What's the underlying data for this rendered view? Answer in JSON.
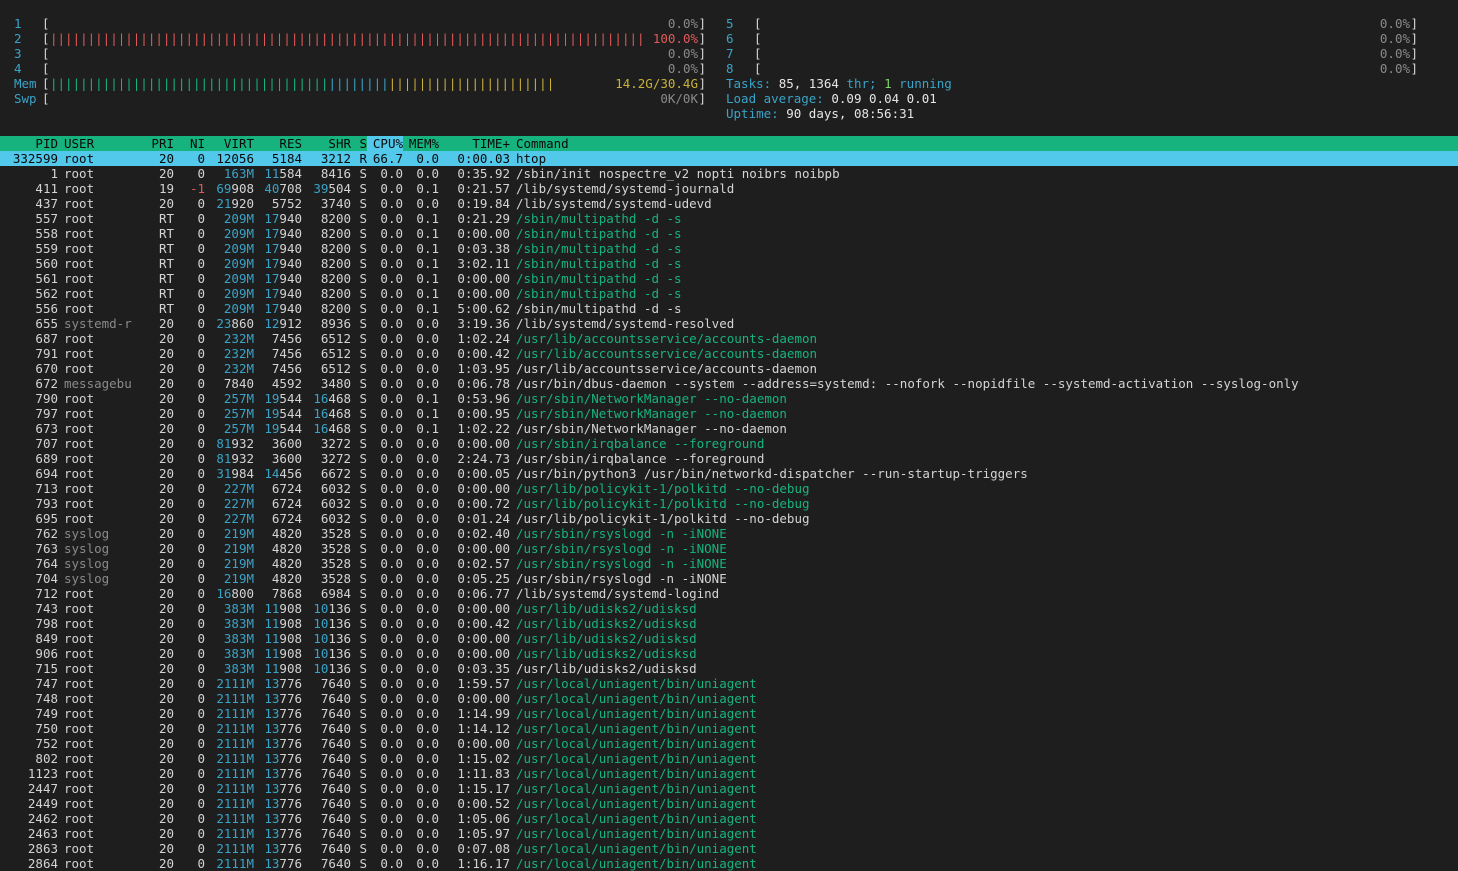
{
  "cpu_meters": {
    "left": [
      {
        "id": "1",
        "value": "0.0%",
        "fill": 0.0
      },
      {
        "id": "2",
        "value": "100.0%",
        "fill": 1.0
      },
      {
        "id": "3",
        "value": "0.0%",
        "fill": 0.0
      },
      {
        "id": "4",
        "value": "0.0%",
        "fill": 0.0
      }
    ],
    "right": [
      {
        "id": "5",
        "value": "0.0%",
        "fill": 0.0
      },
      {
        "id": "6",
        "value": "0.0%",
        "fill": 0.0
      },
      {
        "id": "7",
        "value": "0.0%",
        "fill": 0.0
      },
      {
        "id": "8",
        "value": "0.0%",
        "fill": 0.0
      }
    ]
  },
  "mem": {
    "label": "Mem",
    "value": "14.2G/30.4G",
    "used_fraction": 0.47
  },
  "swap": {
    "label": "Swp",
    "value": "0K/0K",
    "used_fraction": 0.0
  },
  "tasks": {
    "label": "Tasks:",
    "count": "85,",
    "threads": "1364",
    "thr_label": "thr;",
    "running": "1",
    "running_label": "running"
  },
  "load": {
    "label": "Load average:",
    "v1": "0.09",
    "v5": "0.04",
    "v15": "0.01"
  },
  "uptime": {
    "label": "Uptime:",
    "value": "90 days, 08:56:31"
  },
  "columns": {
    "pid": "PID",
    "user": "USER",
    "pri": "PRI",
    "ni": "NI",
    "virt": "VIRT",
    "res": "RES",
    "shr": "SHR",
    "s": "S",
    "cpu": "CPU%",
    "mem": "MEM%",
    "time": "TIME+",
    "command": "Command"
  },
  "colors": {
    "header_bg": "#17b37f",
    "selected_bg": "#52c8ea",
    "thread": "#17b37f",
    "label": "#3aa3c7",
    "cpu_bar": "#e05a5a",
    "mem_bar_used": "#17b37f",
    "mem_bar_buffer": "#3aa3c7",
    "mem_bar_cache": "#c8b23a"
  },
  "processes": [
    {
      "pid": "332599",
      "user": "root",
      "pri": "20",
      "ni": "0",
      "virt": "12056",
      "res": "5184",
      "shr": "3212",
      "s": "R",
      "cpu": "66.7",
      "mem": "0.0",
      "time": "0:00.03",
      "command": "htop",
      "selected": true
    },
    {
      "pid": "1",
      "user": "root",
      "pri": "20",
      "ni": "0",
      "virt": "163M",
      "res": "11584",
      "shr": "8416",
      "s": "S",
      "cpu": "0.0",
      "mem": "0.0",
      "time": "0:35.92",
      "command": "/sbin/init nospectre_v2 nopti noibrs noibpb"
    },
    {
      "pid": "411",
      "user": "root",
      "pri": "19",
      "ni": "-1",
      "virt": "69908",
      "res": "40708",
      "shr": "39504",
      "s": "S",
      "cpu": "0.0",
      "mem": "0.1",
      "time": "0:21.57",
      "command": "/lib/systemd/systemd-journald"
    },
    {
      "pid": "437",
      "user": "root",
      "pri": "20",
      "ni": "0",
      "virt": "21920",
      "res": "5752",
      "shr": "3740",
      "s": "S",
      "cpu": "0.0",
      "mem": "0.0",
      "time": "0:19.84",
      "command": "/lib/systemd/systemd-udevd"
    },
    {
      "pid": "557",
      "user": "root",
      "pri": "RT",
      "ni": "0",
      "virt": "209M",
      "res": "17940",
      "shr": "8200",
      "s": "S",
      "cpu": "0.0",
      "mem": "0.1",
      "time": "0:21.29",
      "command": "/sbin/multipathd -d -s",
      "thread": true
    },
    {
      "pid": "558",
      "user": "root",
      "pri": "RT",
      "ni": "0",
      "virt": "209M",
      "res": "17940",
      "shr": "8200",
      "s": "S",
      "cpu": "0.0",
      "mem": "0.1",
      "time": "0:00.00",
      "command": "/sbin/multipathd -d -s",
      "thread": true
    },
    {
      "pid": "559",
      "user": "root",
      "pri": "RT",
      "ni": "0",
      "virt": "209M",
      "res": "17940",
      "shr": "8200",
      "s": "S",
      "cpu": "0.0",
      "mem": "0.1",
      "time": "0:03.38",
      "command": "/sbin/multipathd -d -s",
      "thread": true
    },
    {
      "pid": "560",
      "user": "root",
      "pri": "RT",
      "ni": "0",
      "virt": "209M",
      "res": "17940",
      "shr": "8200",
      "s": "S",
      "cpu": "0.0",
      "mem": "0.1",
      "time": "3:02.11",
      "command": "/sbin/multipathd -d -s",
      "thread": true
    },
    {
      "pid": "561",
      "user": "root",
      "pri": "RT",
      "ni": "0",
      "virt": "209M",
      "res": "17940",
      "shr": "8200",
      "s": "S",
      "cpu": "0.0",
      "mem": "0.1",
      "time": "0:00.00",
      "command": "/sbin/multipathd -d -s",
      "thread": true
    },
    {
      "pid": "562",
      "user": "root",
      "pri": "RT",
      "ni": "0",
      "virt": "209M",
      "res": "17940",
      "shr": "8200",
      "s": "S",
      "cpu": "0.0",
      "mem": "0.1",
      "time": "0:00.00",
      "command": "/sbin/multipathd -d -s",
      "thread": true
    },
    {
      "pid": "556",
      "user": "root",
      "pri": "RT",
      "ni": "0",
      "virt": "209M",
      "res": "17940",
      "shr": "8200",
      "s": "S",
      "cpu": "0.0",
      "mem": "0.1",
      "time": "5:00.62",
      "command": "/sbin/multipathd -d -s"
    },
    {
      "pid": "655",
      "user": "systemd-r",
      "pri": "20",
      "ni": "0",
      "virt": "23860",
      "res": "12912",
      "shr": "8936",
      "s": "S",
      "cpu": "0.0",
      "mem": "0.0",
      "time": "3:19.36",
      "command": "/lib/systemd/systemd-resolved",
      "dim_user": true
    },
    {
      "pid": "687",
      "user": "root",
      "pri": "20",
      "ni": "0",
      "virt": "232M",
      "res": "7456",
      "shr": "6512",
      "s": "S",
      "cpu": "0.0",
      "mem": "0.0",
      "time": "1:02.24",
      "command": "/usr/lib/accountsservice/accounts-daemon",
      "thread": true
    },
    {
      "pid": "791",
      "user": "root",
      "pri": "20",
      "ni": "0",
      "virt": "232M",
      "res": "7456",
      "shr": "6512",
      "s": "S",
      "cpu": "0.0",
      "mem": "0.0",
      "time": "0:00.42",
      "command": "/usr/lib/accountsservice/accounts-daemon",
      "thread": true
    },
    {
      "pid": "670",
      "user": "root",
      "pri": "20",
      "ni": "0",
      "virt": "232M",
      "res": "7456",
      "shr": "6512",
      "s": "S",
      "cpu": "0.0",
      "mem": "0.0",
      "time": "1:03.95",
      "command": "/usr/lib/accountsservice/accounts-daemon"
    },
    {
      "pid": "672",
      "user": "messagebu",
      "pri": "20",
      "ni": "0",
      "virt": "7840",
      "res": "4592",
      "shr": "3480",
      "s": "S",
      "cpu": "0.0",
      "mem": "0.0",
      "time": "0:06.78",
      "command": "/usr/bin/dbus-daemon --system --address=systemd: --nofork --nopidfile --systemd-activation --syslog-only",
      "dim_user": true
    },
    {
      "pid": "790",
      "user": "root",
      "pri": "20",
      "ni": "0",
      "virt": "257M",
      "res": "19544",
      "shr": "16468",
      "s": "S",
      "cpu": "0.0",
      "mem": "0.1",
      "time": "0:53.96",
      "command": "/usr/sbin/NetworkManager --no-daemon",
      "thread": true
    },
    {
      "pid": "797",
      "user": "root",
      "pri": "20",
      "ni": "0",
      "virt": "257M",
      "res": "19544",
      "shr": "16468",
      "s": "S",
      "cpu": "0.0",
      "mem": "0.1",
      "time": "0:00.95",
      "command": "/usr/sbin/NetworkManager --no-daemon",
      "thread": true
    },
    {
      "pid": "673",
      "user": "root",
      "pri": "20",
      "ni": "0",
      "virt": "257M",
      "res": "19544",
      "shr": "16468",
      "s": "S",
      "cpu": "0.0",
      "mem": "0.1",
      "time": "1:02.22",
      "command": "/usr/sbin/NetworkManager --no-daemon"
    },
    {
      "pid": "707",
      "user": "root",
      "pri": "20",
      "ni": "0",
      "virt": "81932",
      "res": "3600",
      "shr": "3272",
      "s": "S",
      "cpu": "0.0",
      "mem": "0.0",
      "time": "0:00.00",
      "command": "/usr/sbin/irqbalance --foreground",
      "thread": true
    },
    {
      "pid": "689",
      "user": "root",
      "pri": "20",
      "ni": "0",
      "virt": "81932",
      "res": "3600",
      "shr": "3272",
      "s": "S",
      "cpu": "0.0",
      "mem": "0.0",
      "time": "2:24.73",
      "command": "/usr/sbin/irqbalance --foreground"
    },
    {
      "pid": "694",
      "user": "root",
      "pri": "20",
      "ni": "0",
      "virt": "31984",
      "res": "14456",
      "shr": "6672",
      "s": "S",
      "cpu": "0.0",
      "mem": "0.0",
      "time": "0:00.05",
      "command": "/usr/bin/python3 /usr/bin/networkd-dispatcher --run-startup-triggers"
    },
    {
      "pid": "713",
      "user": "root",
      "pri": "20",
      "ni": "0",
      "virt": "227M",
      "res": "6724",
      "shr": "6032",
      "s": "S",
      "cpu": "0.0",
      "mem": "0.0",
      "time": "0:00.00",
      "command": "/usr/lib/policykit-1/polkitd --no-debug",
      "thread": true
    },
    {
      "pid": "793",
      "user": "root",
      "pri": "20",
      "ni": "0",
      "virt": "227M",
      "res": "6724",
      "shr": "6032",
      "s": "S",
      "cpu": "0.0",
      "mem": "0.0",
      "time": "0:00.72",
      "command": "/usr/lib/policykit-1/polkitd --no-debug",
      "thread": true
    },
    {
      "pid": "695",
      "user": "root",
      "pri": "20",
      "ni": "0",
      "virt": "227M",
      "res": "6724",
      "shr": "6032",
      "s": "S",
      "cpu": "0.0",
      "mem": "0.0",
      "time": "0:01.24",
      "command": "/usr/lib/policykit-1/polkitd --no-debug"
    },
    {
      "pid": "762",
      "user": "syslog",
      "pri": "20",
      "ni": "0",
      "virt": "219M",
      "res": "4820",
      "shr": "3528",
      "s": "S",
      "cpu": "0.0",
      "mem": "0.0",
      "time": "0:02.40",
      "command": "/usr/sbin/rsyslogd -n -iNONE",
      "thread": true,
      "dim_user": true
    },
    {
      "pid": "763",
      "user": "syslog",
      "pri": "20",
      "ni": "0",
      "virt": "219M",
      "res": "4820",
      "shr": "3528",
      "s": "S",
      "cpu": "0.0",
      "mem": "0.0",
      "time": "0:00.00",
      "command": "/usr/sbin/rsyslogd -n -iNONE",
      "thread": true,
      "dim_user": true
    },
    {
      "pid": "764",
      "user": "syslog",
      "pri": "20",
      "ni": "0",
      "virt": "219M",
      "res": "4820",
      "shr": "3528",
      "s": "S",
      "cpu": "0.0",
      "mem": "0.0",
      "time": "0:02.57",
      "command": "/usr/sbin/rsyslogd -n -iNONE",
      "thread": true,
      "dim_user": true
    },
    {
      "pid": "704",
      "user": "syslog",
      "pri": "20",
      "ni": "0",
      "virt": "219M",
      "res": "4820",
      "shr": "3528",
      "s": "S",
      "cpu": "0.0",
      "mem": "0.0",
      "time": "0:05.25",
      "command": "/usr/sbin/rsyslogd -n -iNONE",
      "dim_user": true
    },
    {
      "pid": "712",
      "user": "root",
      "pri": "20",
      "ni": "0",
      "virt": "16800",
      "res": "7868",
      "shr": "6984",
      "s": "S",
      "cpu": "0.0",
      "mem": "0.0",
      "time": "0:06.77",
      "command": "/lib/systemd/systemd-logind"
    },
    {
      "pid": "743",
      "user": "root",
      "pri": "20",
      "ni": "0",
      "virt": "383M",
      "res": "11908",
      "shr": "10136",
      "s": "S",
      "cpu": "0.0",
      "mem": "0.0",
      "time": "0:00.00",
      "command": "/usr/lib/udisks2/udisksd",
      "thread": true
    },
    {
      "pid": "798",
      "user": "root",
      "pri": "20",
      "ni": "0",
      "virt": "383M",
      "res": "11908",
      "shr": "10136",
      "s": "S",
      "cpu": "0.0",
      "mem": "0.0",
      "time": "0:00.42",
      "command": "/usr/lib/udisks2/udisksd",
      "thread": true
    },
    {
      "pid": "849",
      "user": "root",
      "pri": "20",
      "ni": "0",
      "virt": "383M",
      "res": "11908",
      "shr": "10136",
      "s": "S",
      "cpu": "0.0",
      "mem": "0.0",
      "time": "0:00.00",
      "command": "/usr/lib/udisks2/udisksd",
      "thread": true
    },
    {
      "pid": "906",
      "user": "root",
      "pri": "20",
      "ni": "0",
      "virt": "383M",
      "res": "11908",
      "shr": "10136",
      "s": "S",
      "cpu": "0.0",
      "mem": "0.0",
      "time": "0:00.00",
      "command": "/usr/lib/udisks2/udisksd",
      "thread": true
    },
    {
      "pid": "715",
      "user": "root",
      "pri": "20",
      "ni": "0",
      "virt": "383M",
      "res": "11908",
      "shr": "10136",
      "s": "S",
      "cpu": "0.0",
      "mem": "0.0",
      "time": "0:03.35",
      "command": "/usr/lib/udisks2/udisksd"
    },
    {
      "pid": "747",
      "user": "root",
      "pri": "20",
      "ni": "0",
      "virt": "2111M",
      "res": "13776",
      "shr": "7640",
      "s": "S",
      "cpu": "0.0",
      "mem": "0.0",
      "time": "1:59.57",
      "command": "/usr/local/uniagent/bin/uniagent",
      "thread": true
    },
    {
      "pid": "748",
      "user": "root",
      "pri": "20",
      "ni": "0",
      "virt": "2111M",
      "res": "13776",
      "shr": "7640",
      "s": "S",
      "cpu": "0.0",
      "mem": "0.0",
      "time": "0:00.00",
      "command": "/usr/local/uniagent/bin/uniagent",
      "thread": true
    },
    {
      "pid": "749",
      "user": "root",
      "pri": "20",
      "ni": "0",
      "virt": "2111M",
      "res": "13776",
      "shr": "7640",
      "s": "S",
      "cpu": "0.0",
      "mem": "0.0",
      "time": "1:14.99",
      "command": "/usr/local/uniagent/bin/uniagent",
      "thread": true
    },
    {
      "pid": "750",
      "user": "root",
      "pri": "20",
      "ni": "0",
      "virt": "2111M",
      "res": "13776",
      "shr": "7640",
      "s": "S",
      "cpu": "0.0",
      "mem": "0.0",
      "time": "1:14.12",
      "command": "/usr/local/uniagent/bin/uniagent",
      "thread": true
    },
    {
      "pid": "752",
      "user": "root",
      "pri": "20",
      "ni": "0",
      "virt": "2111M",
      "res": "13776",
      "shr": "7640",
      "s": "S",
      "cpu": "0.0",
      "mem": "0.0",
      "time": "0:00.00",
      "command": "/usr/local/uniagent/bin/uniagent",
      "thread": true
    },
    {
      "pid": "802",
      "user": "root",
      "pri": "20",
      "ni": "0",
      "virt": "2111M",
      "res": "13776",
      "shr": "7640",
      "s": "S",
      "cpu": "0.0",
      "mem": "0.0",
      "time": "1:15.02",
      "command": "/usr/local/uniagent/bin/uniagent",
      "thread": true
    },
    {
      "pid": "1123",
      "user": "root",
      "pri": "20",
      "ni": "0",
      "virt": "2111M",
      "res": "13776",
      "shr": "7640",
      "s": "S",
      "cpu": "0.0",
      "mem": "0.0",
      "time": "1:11.83",
      "command": "/usr/local/uniagent/bin/uniagent",
      "thread": true
    },
    {
      "pid": "2447",
      "user": "root",
      "pri": "20",
      "ni": "0",
      "virt": "2111M",
      "res": "13776",
      "shr": "7640",
      "s": "S",
      "cpu": "0.0",
      "mem": "0.0",
      "time": "1:15.17",
      "command": "/usr/local/uniagent/bin/uniagent",
      "thread": true
    },
    {
      "pid": "2449",
      "user": "root",
      "pri": "20",
      "ni": "0",
      "virt": "2111M",
      "res": "13776",
      "shr": "7640",
      "s": "S",
      "cpu": "0.0",
      "mem": "0.0",
      "time": "0:00.52",
      "command": "/usr/local/uniagent/bin/uniagent",
      "thread": true
    },
    {
      "pid": "2462",
      "user": "root",
      "pri": "20",
      "ni": "0",
      "virt": "2111M",
      "res": "13776",
      "shr": "7640",
      "s": "S",
      "cpu": "0.0",
      "mem": "0.0",
      "time": "1:05.06",
      "command": "/usr/local/uniagent/bin/uniagent",
      "thread": true
    },
    {
      "pid": "2463",
      "user": "root",
      "pri": "20",
      "ni": "0",
      "virt": "2111M",
      "res": "13776",
      "shr": "7640",
      "s": "S",
      "cpu": "0.0",
      "mem": "0.0",
      "time": "1:05.97",
      "command": "/usr/local/uniagent/bin/uniagent",
      "thread": true
    },
    {
      "pid": "2863",
      "user": "root",
      "pri": "20",
      "ni": "0",
      "virt": "2111M",
      "res": "13776",
      "shr": "7640",
      "s": "S",
      "cpu": "0.0",
      "mem": "0.0",
      "time": "0:07.08",
      "command": "/usr/local/uniagent/bin/uniagent",
      "thread": true
    },
    {
      "pid": "2864",
      "user": "root",
      "pri": "20",
      "ni": "0",
      "virt": "2111M",
      "res": "13776",
      "shr": "7640",
      "s": "S",
      "cpu": "0.0",
      "mem": "0.0",
      "time": "1:16.17",
      "command": "/usr/local/uniagent/bin/uniagent",
      "thread": true
    }
  ]
}
